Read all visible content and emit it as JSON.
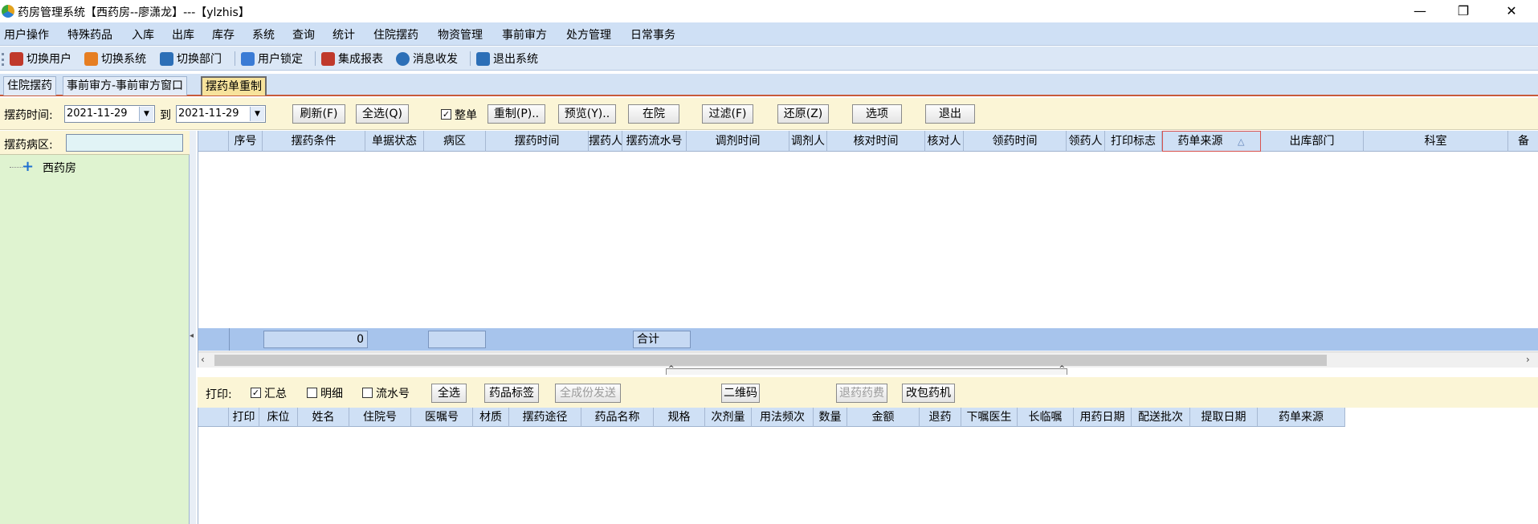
{
  "window": {
    "title": "药房管理系统【西药房--廖潇龙】---【ylzhis】",
    "controls": [
      "—",
      "❐",
      "✕"
    ]
  },
  "menu": [
    "用户操作",
    "特殊药品",
    "入库",
    "出库",
    "库存",
    "系统",
    "查询",
    "统计",
    "住院摆药",
    "物资管理",
    "事前审方",
    "处方管理",
    "日常事务"
  ],
  "toolbar": [
    {
      "label": "切换用户",
      "icon": "switch-user-icon",
      "color": "#c0392b"
    },
    {
      "label": "切换系统",
      "icon": "switch-system-icon",
      "color": "#e67e22"
    },
    {
      "label": "切换部门",
      "icon": "switch-department-icon",
      "color": "#2c6fb7"
    },
    {
      "label": "用户锁定",
      "icon": "user-lock-icon",
      "color": "#3a7bd5"
    },
    {
      "label": "集成报表",
      "icon": "report-icon",
      "color": "#c0392b"
    },
    {
      "label": "消息收发",
      "icon": "info-icon",
      "color": "#2c6fb7"
    },
    {
      "label": "退出系统",
      "icon": "exit-icon",
      "color": "#2c6fb7"
    }
  ],
  "tabs": [
    "住院摆药",
    "事前审方-事前审方窗口",
    "摆药单重制"
  ],
  "active_tab": 2,
  "filter": {
    "time_label": "摆药时间:",
    "date_from": "2021-11-29",
    "to_label": "到",
    "date_to": "2021-11-29",
    "refresh": "刷新(F)",
    "select_all": "全选(Q)",
    "whole_order_label": "整单",
    "whole_order_checked": true,
    "redo": "重制(P)..",
    "preview": "预览(Y)..",
    "in_hospital": "在院",
    "filter": "过滤(F)",
    "restore": "还原(Z)",
    "options": "选项",
    "exit": "退出"
  },
  "left_panel": {
    "ward_label": "摆药病区:",
    "ward_value": "",
    "tree": [
      {
        "label": "西药房",
        "icon": "expand-plus-icon"
      }
    ]
  },
  "upper_grid": {
    "columns": [
      "序号",
      "摆药条件",
      "单据状态",
      "病区",
      "摆药时间",
      "摆药人",
      "摆药流水号",
      "调剂时间",
      "调剂人",
      "核对时间",
      "核对人",
      "领药时间",
      "领药人",
      "打印标志",
      "药单来源",
      "出库部门",
      "科室",
      "备"
    ],
    "sorted_column": "药单来源",
    "sort_indicator": "△",
    "summary": {
      "count": "0",
      "total_label": "合计"
    }
  },
  "bottom_filter": {
    "print_label": "打印:",
    "summary_label": "汇总",
    "summary_checked": true,
    "detail_label": "明细",
    "detail_checked": false,
    "serial_label": "流水号",
    "serial_checked": false,
    "select_all": "全选",
    "drug_label": "药品标签",
    "all_send": "全成份发送",
    "qrcode": "二维码",
    "return_drug": "退药药费",
    "pack_machine": "改包药机"
  },
  "lower_grid": {
    "columns": [
      "打印",
      "床位",
      "姓名",
      "住院号",
      "医嘱号",
      "材质",
      "摆药途径",
      "药品名称",
      "规格",
      "次剂量",
      "用法频次",
      "数量",
      "金额",
      "退药",
      "下嘱医生",
      "长临嘱",
      "用药日期",
      "配送批次",
      "提取日期",
      "药单来源"
    ]
  }
}
